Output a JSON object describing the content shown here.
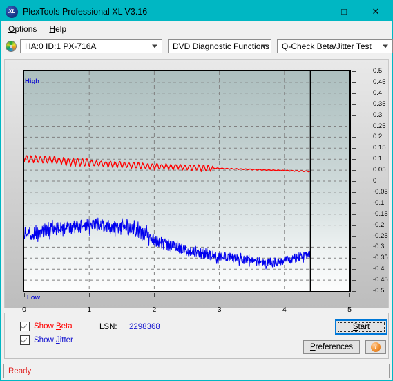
{
  "window": {
    "title": "PlexTools Professional XL V3.16",
    "icon": "xl-disc-icon",
    "minimize": "—",
    "maximize": "□",
    "close": "✕"
  },
  "menu": {
    "items": [
      {
        "label": "Options",
        "accel": "O"
      },
      {
        "label": "Help",
        "accel": "H"
      }
    ]
  },
  "toolbar": {
    "disc_icon": "cd-disc-icon",
    "drive_select": {
      "value": "HA:0 ID:1  PX-716A",
      "options": [
        "HA:0 ID:1  PX-716A"
      ]
    },
    "function_select": {
      "value": "DVD Diagnostic Functions",
      "options": [
        "DVD Diagnostic Functions"
      ]
    },
    "test_select": {
      "value": "Q-Check Beta/Jitter Test",
      "options": [
        "Q-Check Beta/Jitter Test"
      ]
    }
  },
  "controls": {
    "show_beta": {
      "label_pre": "Show ",
      "label_accel": "B",
      "label_post": "eta",
      "checked": true,
      "color": "#ff0000"
    },
    "show_jitter": {
      "label_pre": "Show ",
      "label_accel": "J",
      "label_post": "itter",
      "checked": true,
      "color": "#1414cf"
    },
    "lsn_label": "LSN:",
    "lsn_value": "2298368",
    "start_button": {
      "pre": "",
      "accel": "S",
      "post": "tart"
    },
    "preferences_button": {
      "pre": "",
      "accel": "P",
      "post": "references"
    },
    "info_button": "i"
  },
  "status": {
    "text": "Ready",
    "color": "#e02020"
  },
  "chart_data": {
    "type": "line",
    "title": "Q-Check Beta/Jitter Test",
    "xlabel": "",
    "ylabel": "",
    "xlim": [
      0,
      5
    ],
    "ylim": [
      -0.5,
      0.5
    ],
    "xticks": [
      0,
      1,
      2,
      3,
      4,
      5
    ],
    "yticks": [
      0.5,
      0.45,
      0.4,
      0.35,
      0.3,
      0.25,
      0.2,
      0.15,
      0.1,
      0.05,
      0,
      -0.05,
      -0.1,
      -0.15,
      -0.2,
      -0.25,
      -0.3,
      -0.35,
      -0.4,
      -0.45,
      -0.5
    ],
    "ytick_labels": [
      "0.5",
      "0.45",
      "0.4",
      "0.35",
      "0.3",
      "0.25",
      "0.2",
      "0.15",
      "0.1",
      "0.05",
      "0",
      "-0.05",
      "-0.1",
      "-0.15",
      "-0.2",
      "-0.25",
      "-0.3",
      "-0.35",
      "-0.4",
      "-0.45",
      "-0.5"
    ],
    "axis_end_labels": {
      "top": "High",
      "bottom": "Low"
    },
    "grid": true,
    "grid_style": "dashed",
    "grid_color": "#808080",
    "data_end_marker_x": 4.4,
    "legend_position": "below-left",
    "series": [
      {
        "name": "Beta",
        "color": "#ff0000",
        "x": [
          0.0,
          0.1,
          0.2,
          0.3,
          0.4,
          0.5,
          0.6,
          0.7,
          0.8,
          0.9,
          1.0,
          1.1,
          1.2,
          1.3,
          1.4,
          1.5,
          1.6,
          1.7,
          1.8,
          1.9,
          2.0,
          2.1,
          2.2,
          2.3,
          2.4,
          2.5,
          2.6,
          2.7,
          2.8,
          2.9,
          3.0,
          3.1,
          3.2,
          3.3,
          3.4,
          3.5,
          3.6,
          3.7,
          3.8,
          3.9,
          4.0,
          4.1,
          4.2,
          4.3,
          4.4
        ],
        "values": [
          0.105,
          0.102,
          0.1,
          0.098,
          0.097,
          0.095,
          0.093,
          0.09,
          0.088,
          0.086,
          0.084,
          0.082,
          0.08,
          0.079,
          0.078,
          0.076,
          0.074,
          0.072,
          0.07,
          0.069,
          0.068,
          0.067,
          0.066,
          0.065,
          0.064,
          0.063,
          0.062,
          0.061,
          0.06,
          0.059,
          0.058,
          0.057,
          0.056,
          0.055,
          0.054,
          0.053,
          0.052,
          0.051,
          0.05,
          0.049,
          0.048,
          0.047,
          0.046,
          0.045,
          0.044
        ],
        "noise_amplitude": 0.018,
        "noise_kind": "sawtooth"
      },
      {
        "name": "Jitter",
        "color": "#0000ee",
        "x": [
          0.0,
          0.1,
          0.2,
          0.3,
          0.4,
          0.5,
          0.6,
          0.7,
          0.8,
          0.9,
          1.0,
          1.1,
          1.2,
          1.3,
          1.4,
          1.5,
          1.6,
          1.7,
          1.8,
          1.9,
          2.0,
          2.1,
          2.2,
          2.3,
          2.4,
          2.5,
          2.6,
          2.7,
          2.8,
          2.9,
          3.0,
          3.1,
          3.2,
          3.3,
          3.4,
          3.5,
          3.6,
          3.7,
          3.8,
          3.9,
          4.0,
          4.1,
          4.2,
          4.3,
          4.4
        ],
        "values": [
          -0.235,
          -0.24,
          -0.235,
          -0.225,
          -0.22,
          -0.218,
          -0.215,
          -0.212,
          -0.208,
          -0.205,
          -0.2,
          -0.195,
          -0.198,
          -0.205,
          -0.212,
          -0.215,
          -0.218,
          -0.222,
          -0.235,
          -0.252,
          -0.268,
          -0.28,
          -0.29,
          -0.3,
          -0.308,
          -0.316,
          -0.322,
          -0.328,
          -0.332,
          -0.336,
          -0.34,
          -0.344,
          -0.348,
          -0.352,
          -0.356,
          -0.36,
          -0.364,
          -0.368,
          -0.37,
          -0.368,
          -0.362,
          -0.354,
          -0.346,
          -0.34,
          -0.336
        ],
        "noise_amplitude": 0.03,
        "noise_kind": "dense-random"
      }
    ]
  }
}
